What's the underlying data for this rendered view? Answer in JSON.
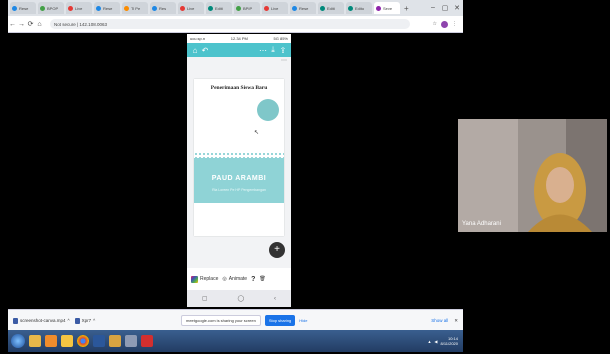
{
  "browser": {
    "tabs": [
      {
        "label": "Rese",
        "color": "#1e88e5"
      },
      {
        "label": "BPOP",
        "color": "#43a047"
      },
      {
        "label": "Live",
        "color": "#e53935"
      },
      {
        "label": "Rese",
        "color": "#1e88e5"
      },
      {
        "label": "Ti Pe",
        "color": "#fb8c00"
      },
      {
        "label": "Res",
        "color": "#1e88e5"
      },
      {
        "label": "Live",
        "color": "#e53935"
      },
      {
        "label": "Editi",
        "color": "#00897b"
      },
      {
        "label": "BPIP",
        "color": "#43a047"
      },
      {
        "label": "Live",
        "color": "#e53935"
      },
      {
        "label": "Rese",
        "color": "#1e88e5"
      },
      {
        "label": "Editi",
        "color": "#00897b"
      },
      {
        "label": "Edito",
        "color": "#00897b"
      },
      {
        "label": "Seve",
        "color": "#8e24aa",
        "active": true
      }
    ],
    "new_tab": "+",
    "url": "Not secure | 142.108.0063"
  },
  "phone": {
    "status_left": "ucu.sp.n",
    "status_center": "12.34 PM",
    "status_right": "5G 85%",
    "card_title": "Penerimaan Siswa Baru",
    "band_title": "PAUD ARAMBI",
    "band_subtitle": "Ria Loreen Pe HP Pengembangan",
    "bottom": {
      "replace": "Replace",
      "animate": "Animate"
    }
  },
  "downloads": {
    "file1": "screenshot-canva.mp4",
    "file2": "Xpr7",
    "show_all": "Show all"
  },
  "share_banner": {
    "message": "meetgoogle.com is sharing your screen",
    "stop": "Stop sharing",
    "hide": "Hide"
  },
  "taskbar": {
    "time": "10:14",
    "date": "8/11/2020"
  },
  "participant": {
    "name": "Yana Adharani"
  },
  "colors": {
    "canva_teal": "#4dc3cc",
    "band": "#8fd3d6",
    "circle": "#7fc7c9",
    "stop_button": "#1a73e8"
  }
}
